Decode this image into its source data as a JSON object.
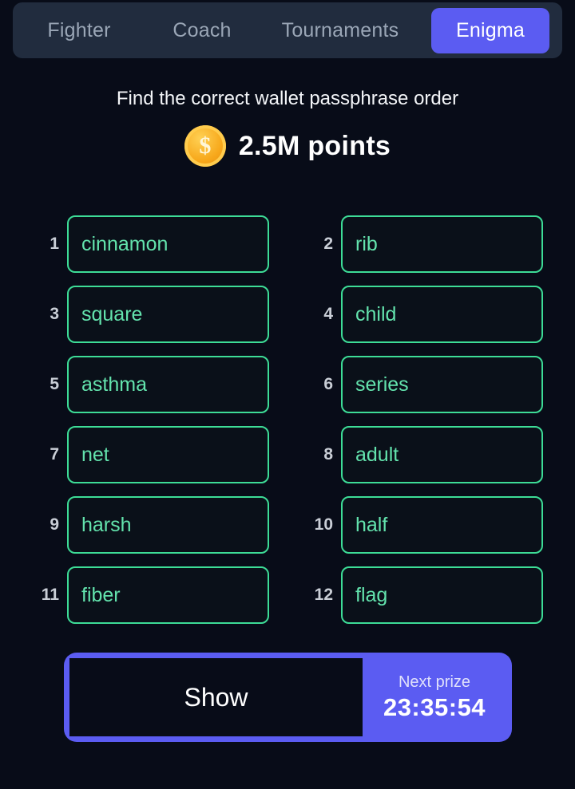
{
  "nav": {
    "tabs": [
      {
        "label": "Fighter",
        "active": false
      },
      {
        "label": "Coach",
        "active": false
      },
      {
        "label": "Tournaments",
        "active": false
      },
      {
        "label": "Enigma",
        "active": true
      }
    ]
  },
  "header": {
    "subtitle": "Find the correct wallet passphrase order",
    "coin_icon": "coin-dollar-icon",
    "points": "2.5M points"
  },
  "grid": {
    "cells": [
      {
        "index": "1",
        "word": "cinnamon"
      },
      {
        "index": "2",
        "word": "rib"
      },
      {
        "index": "3",
        "word": "square"
      },
      {
        "index": "4",
        "word": "child"
      },
      {
        "index": "5",
        "word": "asthma"
      },
      {
        "index": "6",
        "word": "series"
      },
      {
        "index": "7",
        "word": "net"
      },
      {
        "index": "8",
        "word": "adult"
      },
      {
        "index": "9",
        "word": "harsh"
      },
      {
        "index": "10",
        "word": "half"
      },
      {
        "index": "11",
        "word": "fiber"
      },
      {
        "index": "12",
        "word": "flag"
      }
    ]
  },
  "action_bar": {
    "show_label": "Show",
    "prize_title": "Next prize",
    "prize_timer": "23:35:54"
  },
  "colors": {
    "background": "#080c18",
    "navbar": "#212c3e",
    "accent_indigo": "#5b5cf2",
    "word_border_green": "#3ddc97",
    "word_text_green": "#63e3ad",
    "coin_gold": "#f7a81b"
  }
}
